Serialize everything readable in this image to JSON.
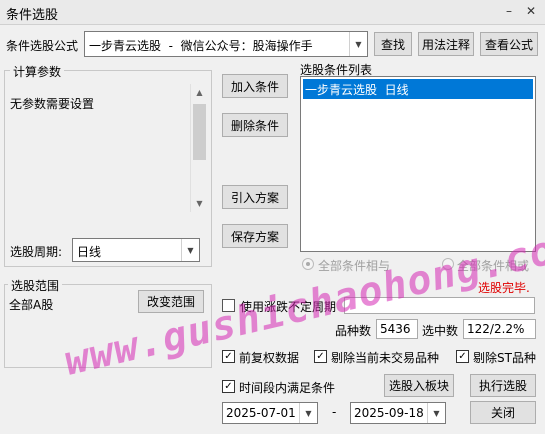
{
  "window": {
    "title": "条件选股",
    "minimize_glyph": "–",
    "close_glyph": "✕"
  },
  "formula": {
    "label": "条件选股公式",
    "value": "一步青云选股  -  微信公众号：股海操作手",
    "find_button": "查找",
    "usage_button": "用法注释",
    "view_button": "查看公式"
  },
  "params": {
    "group_label": "计算参数",
    "text": "无参数需要设置",
    "period_label": "选股周期:",
    "period_value": "日线"
  },
  "conditions": {
    "add_button": "加入条件",
    "delete_button": "删除条件",
    "import_button": "引入方案",
    "save_button": "保存方案",
    "list_label": "选股条件列表",
    "items": [
      "一步青云选股  日线"
    ],
    "logic_and": "全部条件相与",
    "logic_or": "全部条件相或"
  },
  "range": {
    "group_label": "选股范围",
    "value": "全部A股",
    "change_button": "改变范围"
  },
  "status": {
    "done_text": "选股完毕.",
    "done_color": "#e00000",
    "use_period_label": "使用涨跌不定周期",
    "count_label": "品种数",
    "count_value": "5436",
    "selected_label": "选中数",
    "selected_value": "122/2.2%"
  },
  "options": {
    "adjust_label": "前复权数据",
    "adjust_checked": "✓",
    "exclude_untraded_label": "剔除当前未交易品种",
    "exclude_untraded_checked": "✓",
    "exclude_st_label": "剔除ST品种",
    "exclude_st_checked": "✓",
    "time_range_label": "时间段内满足条件",
    "time_range_checked": "✓"
  },
  "actions": {
    "to_block_button": "选股入板块",
    "run_button": "执行选股",
    "close_button": "关闭",
    "start_date": "2025-07-01",
    "date_separator": "-",
    "end_date": "2025-09-18"
  },
  "watermark": "www.gushichaohong.com"
}
